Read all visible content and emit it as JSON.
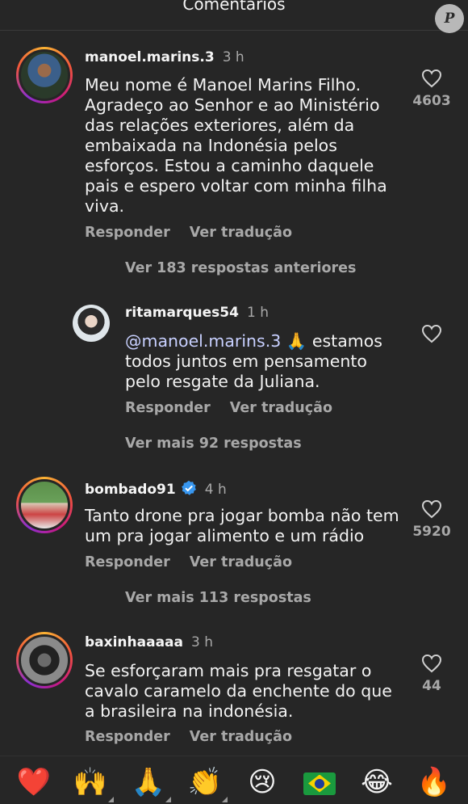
{
  "header": {
    "title": "Comentários",
    "watermark": "P"
  },
  "comments": [
    {
      "username": "manoel.marins.3",
      "time": "3 h",
      "text": "Meu nome é Manoel Marins Filho. Agradeço ao Senhor e ao Ministério das relações exteriores, além da embaixada na Indonésia pelos esforços. Estou a caminho daquele pais e espero voltar com minha filha viva.",
      "likes": "4603",
      "reply_label": "Responder",
      "translate_label": "Ver tradução",
      "more_label": "Ver 183 respostas anteriores"
    },
    {
      "username": "ritamarques54",
      "time": "1 h",
      "mention": "@manoel.marins.3",
      "emoji": "🙏",
      "text": " estamos todos juntos em pensamento pelo resgate da Juliana.",
      "reply_label": "Responder",
      "translate_label": "Ver tradução",
      "more_label": "Ver mais 92 respostas"
    },
    {
      "username": "bombado91",
      "time": "4 h",
      "text": "Tanto drone pra jogar bomba não tem um pra jogar alimento e um rádio",
      "likes": "5920",
      "reply_label": "Responder",
      "translate_label": "Ver tradução",
      "more_label": "Ver mais 113 respostas"
    },
    {
      "username": "baxinhaaaaa",
      "time": "3 h",
      "text": "Se esforçaram mais pra resgatar o cavalo caramelo da enchente do que a brasileira na indonésia.",
      "likes": "44",
      "reply_label": "Responder",
      "translate_label": "Ver tradução"
    }
  ],
  "reactions": [
    "❤️",
    "🙌",
    "🙏",
    "👏",
    "😢",
    "brazil-flag",
    "😂",
    "🔥"
  ],
  "colors": {
    "background": "#262626",
    "verified": "#3897f0",
    "secondary_text": "#a8a8a8"
  }
}
